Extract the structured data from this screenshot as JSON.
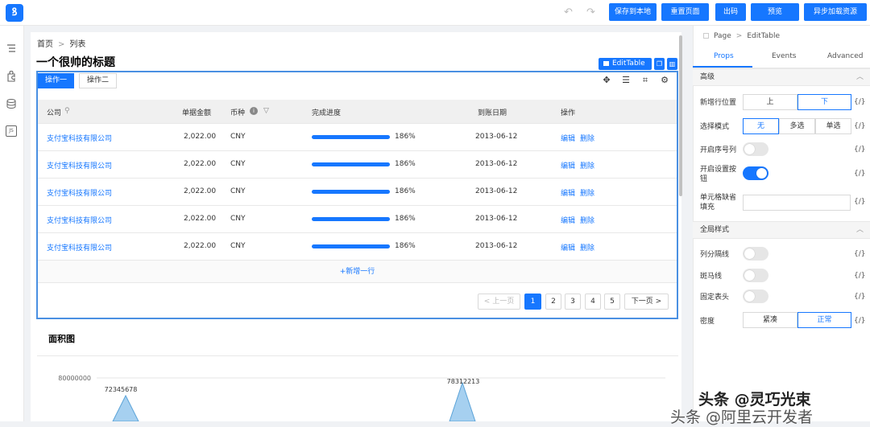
{
  "app": {
    "logo_text": "ꝸ"
  },
  "toolbar": {
    "undo_glyph": "↶",
    "redo_glyph": "↷",
    "buttons": [
      "保存到本地",
      "重置页面",
      "出码",
      "预览",
      "异步加载资源"
    ]
  },
  "leftbar": {
    "icons": [
      "outline-icon",
      "component-icon",
      "datasource-icon",
      "js-icon"
    ],
    "js_label": "JS"
  },
  "breadcrumb": {
    "home": "首页",
    "separator": ">",
    "current": "列表"
  },
  "page_title": "一个很帅的标题",
  "selection": {
    "component_label": "EditTable"
  },
  "tabs": [
    {
      "label": "操作一",
      "active": true
    },
    {
      "label": "操作二",
      "active": false
    }
  ],
  "table": {
    "columns": [
      "公司",
      "单据金额",
      "币种",
      "完成进度",
      "到账日期",
      "操作"
    ],
    "rows": [
      {
        "company": "支付宝科技有限公司",
        "amount": "2,022.00",
        "currency": "CNY",
        "progress_label": "186%",
        "progress": 1.0,
        "date": "2013-06-12",
        "edit": "编辑",
        "delete": "删除"
      },
      {
        "company": "支付宝科技有限公司",
        "amount": "2,022.00",
        "currency": "CNY",
        "progress_label": "186%",
        "progress": 1.0,
        "date": "2013-06-12",
        "edit": "编辑",
        "delete": "删除"
      },
      {
        "company": "支付宝科技有限公司",
        "amount": "2,022.00",
        "currency": "CNY",
        "progress_label": "186%",
        "progress": 1.0,
        "date": "2013-06-12",
        "edit": "编辑",
        "delete": "删除"
      },
      {
        "company": "支付宝科技有限公司",
        "amount": "2,022.00",
        "currency": "CNY",
        "progress_label": "186%",
        "progress": 1.0,
        "date": "2013-06-12",
        "edit": "编辑",
        "delete": "删除"
      },
      {
        "company": "支付宝科技有限公司",
        "amount": "2,022.00",
        "currency": "CNY",
        "progress_label": "186%",
        "progress": 1.0,
        "date": "2013-06-12",
        "edit": "编辑",
        "delete": "删除"
      }
    ],
    "add_row": "+新增一行"
  },
  "pagination": {
    "prev": "< 上一页",
    "pages": [
      "1",
      "2",
      "3",
      "4",
      "5"
    ],
    "current": "1",
    "next": "下一页 >"
  },
  "area_chart": {
    "title": "面积图"
  },
  "chart_data": {
    "type": "area",
    "title": "面积图",
    "y_tick_labels": [
      "80000000"
    ],
    "annotations": [
      "72345678",
      "78312213"
    ],
    "peaks": [
      72345678,
      78312213
    ],
    "ylim": [
      0,
      80000000
    ],
    "grid": true
  },
  "right_panel": {
    "breadcrumb": {
      "page": "Page",
      "separator": ">",
      "current": "EditTable"
    },
    "tabs": [
      "Props",
      "Events",
      "Advanced"
    ],
    "active_tab": "Props",
    "section_advanced": "高级",
    "section_global": "全局样式",
    "var_glyph": "{/}",
    "new_row_position": {
      "label": "新增行位置",
      "options": [
        "上",
        "下"
      ],
      "selected": "下"
    },
    "select_mode": {
      "label": "选择模式",
      "options": [
        "无",
        "多选",
        "单选"
      ],
      "selected": "无"
    },
    "show_index": {
      "label": "开启序号列",
      "value": false
    },
    "show_settings": {
      "label": "开启设置按钮",
      "value": true
    },
    "cell_fill": {
      "label": "单元格缺省填充",
      "value": ""
    },
    "col_divider": {
      "label": "列分隔线",
      "value": false
    },
    "zebra": {
      "label": "斑马线",
      "value": false
    },
    "fixed_header": {
      "label": "固定表头",
      "value": false
    },
    "density": {
      "label": "密度",
      "options": [
        "紧凑",
        "正常"
      ],
      "selected": "正常"
    }
  },
  "watermark": {
    "line1": "头条 @灵巧光束",
    "line2": "头条 @",
    "line2_tail": "阿里云开发者"
  },
  "colors": {
    "primary": "#1677ff",
    "selection_border": "#4a90e2",
    "area_fill": "#a6d0f0"
  }
}
